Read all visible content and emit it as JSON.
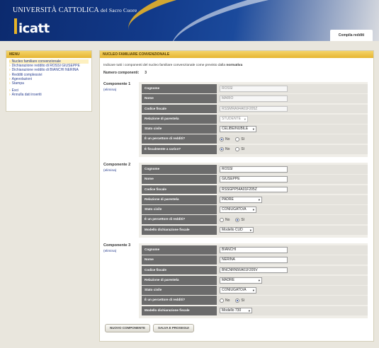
{
  "header": {
    "university": "UNIVERSITÀ CATTOLICA",
    "university_sub": "del Sacro Cuore",
    "logo": "icatt",
    "tab_label": "Compila redditi"
  },
  "menu": {
    "title": "MENU",
    "items": [
      {
        "label": "Nucleo familiare convenzionale"
      },
      {
        "label": "Dichiarazione reddito di  ROSSI GIUSEPPE"
      },
      {
        "label": "Dichiarazione reddito di  BIANCHI NERINA"
      },
      {
        "label": "Redditi complessivi"
      },
      {
        "label": "Agevolazioni"
      },
      {
        "label": "Stampa"
      },
      {
        "label": "Esci"
      },
      {
        "label": "Annulla dati inseriti"
      }
    ]
  },
  "main": {
    "title": "NUCLEO FAMILIARE CONVENZIONALE",
    "intro": "Indicare tutti i componenti del nucleo familiare convenzionale come previsto dalla",
    "intro_bold": "normativa",
    "num_label": "Numero componenti:",
    "num_value": "3",
    "labels": {
      "cognome": "Cognome",
      "nome": "Nome",
      "cf": "Codice fiscale",
      "relazione": "Relazione di parentela",
      "stato": "Stato civile",
      "percettore": "È un percettore di redditi?",
      "carico": "È fiscalmente a carico?",
      "modello": "Modello dichiarazione fiscale",
      "no": "No",
      "si": "Sì"
    },
    "elimina": "(elimina)",
    "components": [
      {
        "title": "Componente 1",
        "cognome": "ROSSI",
        "nome": "MARIO",
        "cf": "RSSMRA94A01F205Z",
        "relazione": "STUDENTE",
        "stato": "CELIBE/NUBILE",
        "percettore": "No",
        "carico": "No"
      },
      {
        "title": "Componente 2",
        "cognome": "ROSSI",
        "nome": "GIUSEPPE",
        "cf": "RSSGPP54A01F205Z",
        "relazione": "PADRE",
        "stato": "CONIUGATO/A",
        "percettore": "Sì",
        "modello": "Modello CUD"
      },
      {
        "title": "Componente 3",
        "cognome": "BIANCHI",
        "nome": "NERINA",
        "cf": "BNCNRN56A01F205V",
        "relazione": "MADRE",
        "stato": "CONIUGATO/A",
        "percettore": "Sì",
        "modello": "Modello 730"
      }
    ],
    "btn_new": "NUOVO COMPONENTE",
    "btn_save": "SALVA E PROSEGUI"
  }
}
